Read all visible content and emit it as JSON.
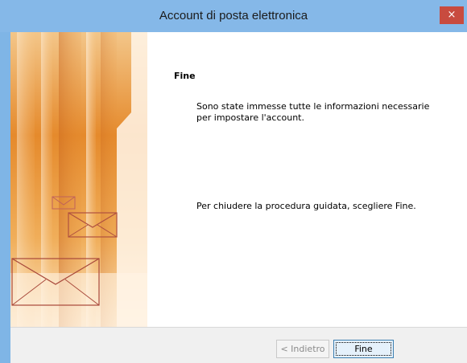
{
  "window": {
    "title": "Account di posta elettronica",
    "close_glyph": "×"
  },
  "wizard": {
    "heading": "Fine",
    "message1": "Sono state immesse tutte le informazioni necessarie per impostare l'account.",
    "message2": "Per chiudere la procedura guidata, scegliere Fine."
  },
  "buttons": {
    "back_label": "< Indietro",
    "finish_label": "Fine"
  },
  "colors": {
    "titlebar": "#85b8e8",
    "close": "#c84b3f",
    "banner_orange": "#e8882c",
    "footer": "#f0f0f0"
  },
  "icons": {
    "banner": "envelope-illustration",
    "close": "close-icon"
  }
}
